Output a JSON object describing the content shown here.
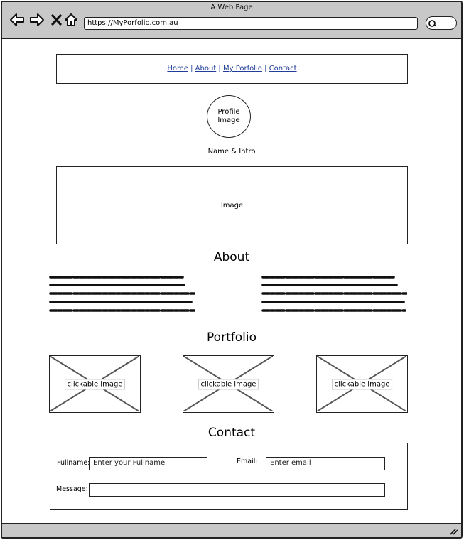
{
  "window": {
    "title": "A Web Page"
  },
  "browser": {
    "url": "https://MyPorfolio.com.au"
  },
  "nav": {
    "links": [
      "Home",
      "About",
      "My Porfolio",
      "Contact"
    ],
    "separator": " | "
  },
  "profile": {
    "image_label": "Profile Image"
  },
  "intro": {
    "text": "Name & Intro"
  },
  "hero": {
    "label": "Image"
  },
  "about": {
    "heading": "About"
  },
  "portfolio": {
    "heading": "Portfolio",
    "items": [
      {
        "label": "clickable image"
      },
      {
        "label": "clickable image"
      },
      {
        "label": "clickable image"
      }
    ]
  },
  "contact": {
    "heading": "Contact",
    "fullname_label": "Fullname:",
    "fullname_placeholder": "Enter your Fullname",
    "email_label": "Email:",
    "email_placeholder": "Enter email",
    "message_label": "Message:",
    "message_value": ""
  }
}
